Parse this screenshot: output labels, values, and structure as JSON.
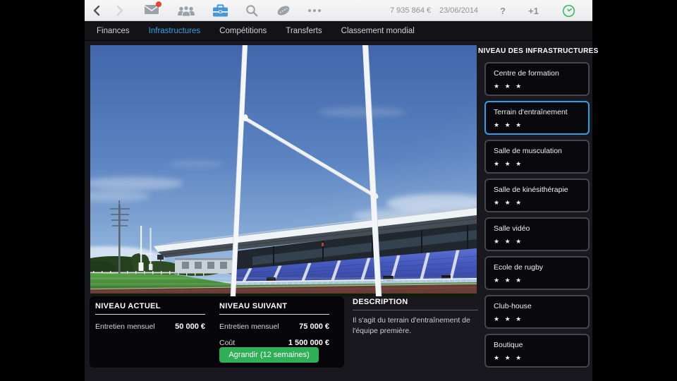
{
  "topbar": {
    "money": "7 935 864 €",
    "date": "23/06/2014",
    "help": "?",
    "plus_one": "+1",
    "icons": [
      "back-icon",
      "forward-icon",
      "mail-icon",
      "team-icon",
      "briefcase-icon",
      "search-icon",
      "rugby-ball-icon",
      "more-icon",
      "clock-icon"
    ]
  },
  "nav": {
    "tabs": [
      {
        "label": "Finances",
        "active": false
      },
      {
        "label": "Infrastructures",
        "active": true
      },
      {
        "label": "Compétitions",
        "active": false
      },
      {
        "label": "Transferts",
        "active": false
      },
      {
        "label": "Classement mondial",
        "active": false
      }
    ]
  },
  "sidebar": {
    "title": "NIVEAU DES INFRASTRUCTURES",
    "items": [
      {
        "label": "Centre de formation",
        "stars": 3,
        "selected": false
      },
      {
        "label": "Terrain d'entraînement",
        "stars": 3,
        "selected": true
      },
      {
        "label": "Salle de musculation",
        "stars": 3,
        "selected": false
      },
      {
        "label": "Salle de kinésithérapie",
        "stars": 3,
        "selected": false
      },
      {
        "label": "Salle vidéo",
        "stars": 3,
        "selected": false
      },
      {
        "label": "Ecole de rugby",
        "stars": 3,
        "selected": false
      },
      {
        "label": "Club-house",
        "stars": 3,
        "selected": false
      },
      {
        "label": "Boutique",
        "stars": 3,
        "selected": false
      }
    ]
  },
  "panels": {
    "current": {
      "title": "NIVEAU ACTUEL",
      "rows": [
        {
          "label": "Entretien mensuel",
          "value": "50 000 €"
        }
      ]
    },
    "next": {
      "title": "NIVEAU SUIVANT",
      "rows": [
        {
          "label": "Entretien mensuel",
          "value": "75 000 €"
        },
        {
          "label": "Coût",
          "value": "1 500 000 €"
        }
      ],
      "button": "Agrandir (12 semaines)"
    },
    "description": {
      "title": "DESCRIPTION",
      "text": "Il s'agit du terrain d'entraînement de l'équipe première."
    }
  },
  "colors": {
    "selected_border": "#2d9fe8",
    "tab_active": "#35a2ea",
    "button_green": "#2fb057",
    "briefcase_blue": "#4796d8",
    "badge_red": "#e8432d",
    "clock_green": "#3fbb66",
    "icon_gray": "#9aa1a8"
  }
}
